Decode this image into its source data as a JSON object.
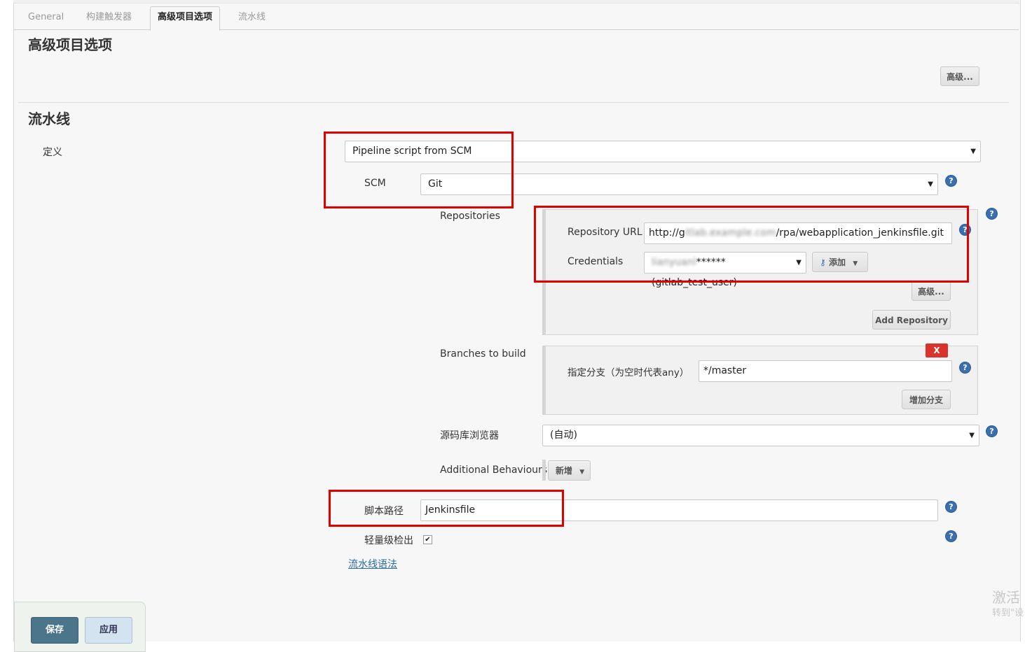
{
  "tabs": [
    {
      "label": "General"
    },
    {
      "label": "构建触发器"
    },
    {
      "label": "高级项目选项"
    },
    {
      "label": "流水线"
    }
  ],
  "advanced_section": {
    "title": "高级项目选项",
    "advanced_button": "高级..."
  },
  "pipeline_section": {
    "title": "流水线",
    "definition_label": "定义",
    "definition_value": "Pipeline script from SCM",
    "scm_label": "SCM",
    "scm_value": "Git",
    "repositories_label": "Repositories",
    "repository_url_label": "Repository URL",
    "repository_url_value_prefix": "http://g",
    "repository_url_value_suffix": "/rpa/webapplication_jenkinsfile.git",
    "credentials_label": "Credentials",
    "credentials_value_suffix": "****** (gitlab_test_user)",
    "add_credentials_button": "添加",
    "repo_advanced_button": "高级...",
    "add_repository_button": "Add Repository",
    "branches_label": "Branches to build",
    "branch_delete_button": "X",
    "branch_specifier_label": "指定分支（为空时代表any）",
    "branch_specifier_value": "*/master",
    "add_branch_button": "增加分支",
    "repo_browser_label": "源码库浏览器",
    "repo_browser_value": "(自动)",
    "additional_behaviours_label": "Additional Behaviours",
    "add_behaviour_button": "新增",
    "script_path_label": "脚本路径",
    "script_path_value": "Jenkinsfile",
    "lightweight_checkout_label": "轻量级检出",
    "lightweight_checkout_checked": true,
    "pipeline_syntax_link": "流水线语法"
  },
  "footer": {
    "save_button": "保存",
    "apply_button": "应用"
  },
  "watermark": {
    "line1": "激活",
    "line2": "转到\"设"
  },
  "help_icon_glyph": "?"
}
